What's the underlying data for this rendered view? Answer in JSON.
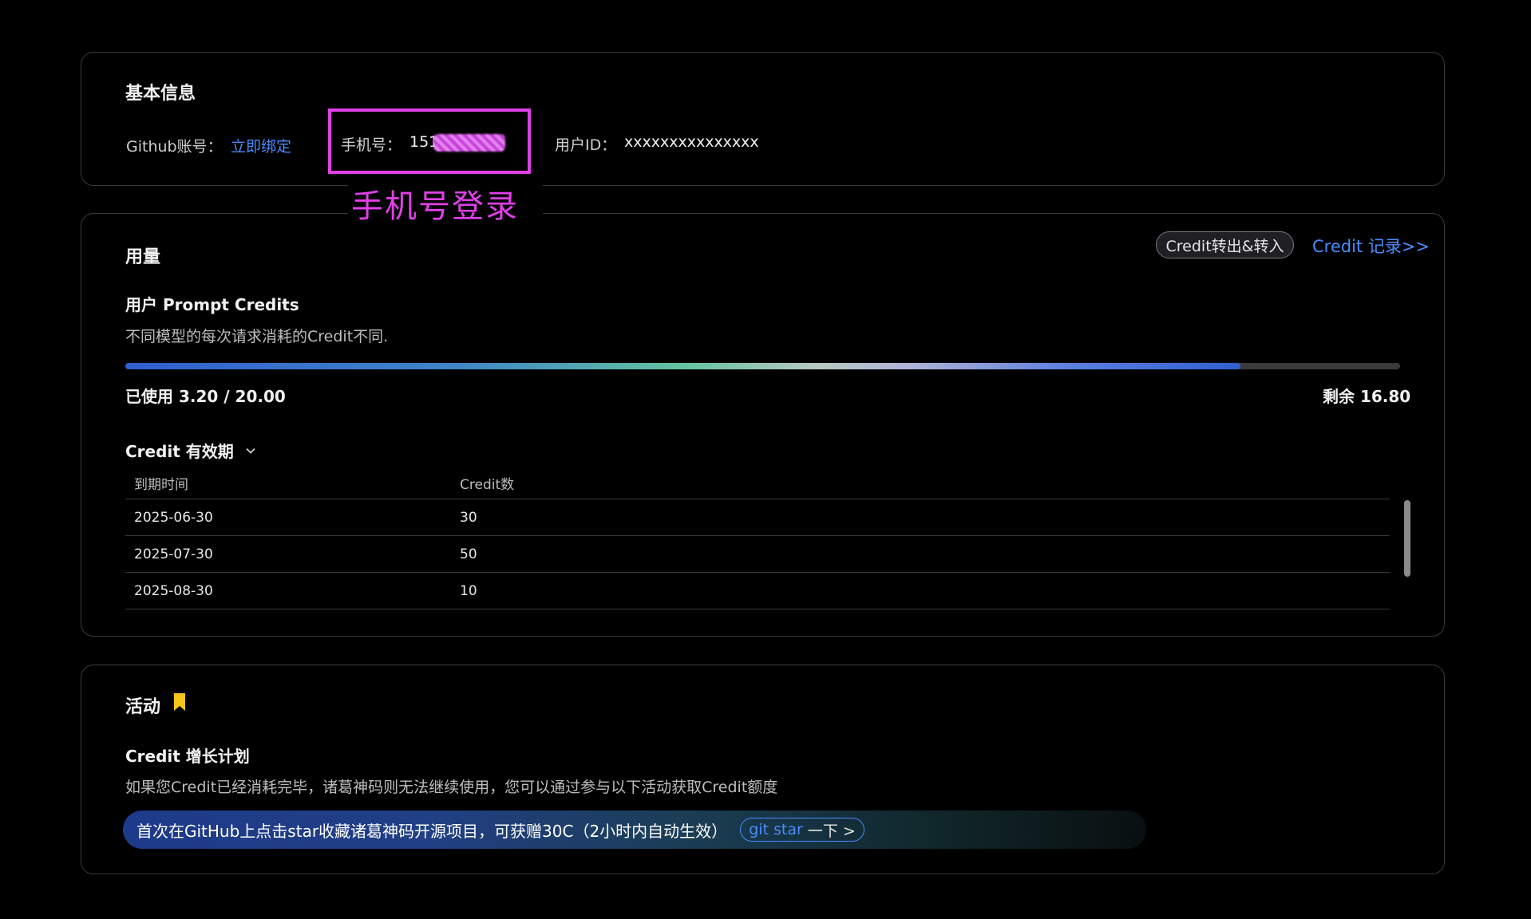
{
  "basic_info": {
    "title": "基本信息",
    "github_label": "Github账号：",
    "github_action": "立即绑定",
    "phone_label": "手机号：",
    "phone_value": "151",
    "user_id_label": "用户ID：",
    "user_id_value": "xxxxxxxxxxxxxxx"
  },
  "annotation": {
    "caption": "手机号登录",
    "color": "#e040e8"
  },
  "usage": {
    "title": "用量",
    "transfer_button": "Credit转出&转入",
    "records_link": "Credit 记录>>",
    "credits_title": "用户 Prompt Credits",
    "credits_desc": "不同模型的每次请求消耗的Credit不同.",
    "used_text": "已使用 3.20 / 20.00",
    "remaining_text": "剩余 16.80",
    "used": 3.2,
    "total": 20.0,
    "progress_fill_fraction": 0.875,
    "expiry_toggle": "Credit 有效期",
    "table": {
      "headers": [
        "到期时间",
        "Credit数"
      ],
      "rows": [
        [
          "2025-06-30",
          "30"
        ],
        [
          "2025-07-30",
          "50"
        ],
        [
          "2025-08-30",
          "10"
        ]
      ]
    }
  },
  "activity": {
    "title": "活动",
    "icon": "bookmark-icon",
    "plan_title": "Credit 增长计划",
    "plan_desc": "如果您Credit已经消耗完毕，诸葛神码则无法继续使用，您可以通过参与以下活动获取Credit额度",
    "banner_text": "首次在GitHub上点击star收藏诸葛神码开源项目，可获赠30C（2小时内自动生效）",
    "git_star_accent": "git star",
    "git_star_rest": "一下 >"
  },
  "colors": {
    "accent": "#4a8cff",
    "bookmark": "#f5c518",
    "background": "#000000"
  }
}
